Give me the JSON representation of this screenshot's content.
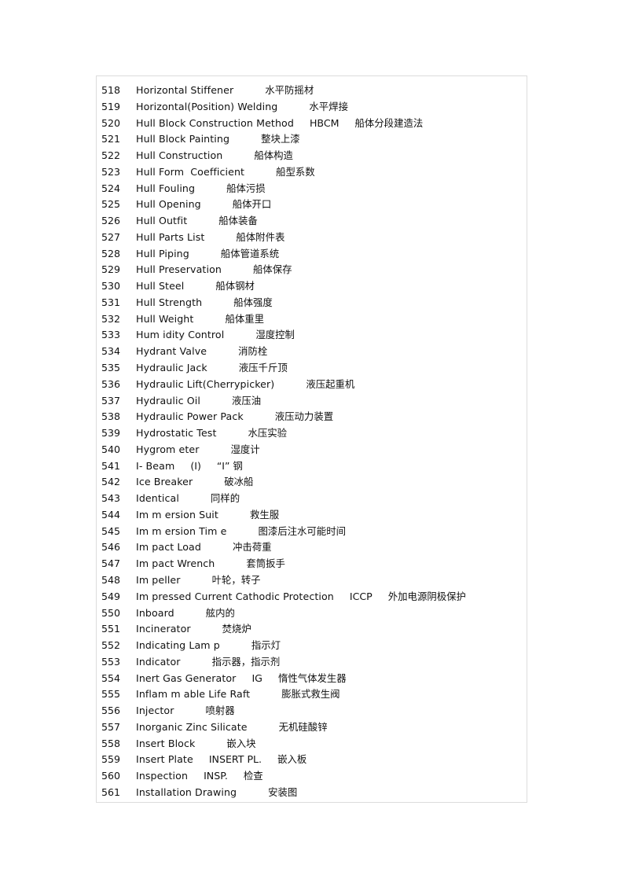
{
  "glossary": {
    "entries": [
      {
        "num": "518",
        "term": "Horizontal Stiffener",
        "abbr": "",
        "zh": "水平防摇材"
      },
      {
        "num": "519",
        "term": "Horizontal(Position) Welding",
        "abbr": "",
        "zh": "水平焊接"
      },
      {
        "num": "520",
        "term": "Hull Block Construction Method",
        "abbr": "HBCM",
        "zh": "船体分段建造法"
      },
      {
        "num": "521",
        "term": "Hull Block Painting",
        "abbr": "",
        "zh": "整块上漆"
      },
      {
        "num": "522",
        "term": "Hull Construction",
        "abbr": "",
        "zh": "船体构造"
      },
      {
        "num": "523",
        "term": "Hull Form  Coefficient",
        "abbr": "",
        "zh": "船型系数"
      },
      {
        "num": "524",
        "term": "Hull Fouling",
        "abbr": "",
        "zh": "船体污损"
      },
      {
        "num": "525",
        "term": "Hull Opening",
        "abbr": "",
        "zh": "船体开口"
      },
      {
        "num": "526",
        "term": "Hull Outfit",
        "abbr": "",
        "zh": "船体装备"
      },
      {
        "num": "527",
        "term": "Hull Parts List",
        "abbr": "",
        "zh": "船体附件表"
      },
      {
        "num": "528",
        "term": "Hull Piping",
        "abbr": "",
        "zh": "船体管道系统"
      },
      {
        "num": "529",
        "term": "Hull Preservation",
        "abbr": "",
        "zh": "船体保存"
      },
      {
        "num": "530",
        "term": "Hull Steel",
        "abbr": "",
        "zh": "船体钢材"
      },
      {
        "num": "531",
        "term": "Hull Strength",
        "abbr": "",
        "zh": "船体强度"
      },
      {
        "num": "532",
        "term": "Hull Weight",
        "abbr": "",
        "zh": "船体重里"
      },
      {
        "num": "533",
        "term": "Hum idity Control",
        "abbr": "",
        "zh": "湿度控制"
      },
      {
        "num": "534",
        "term": "Hydrant Valve",
        "abbr": "",
        "zh": "消防栓"
      },
      {
        "num": "535",
        "term": "Hydraulic Jack",
        "abbr": "",
        "zh": "液压千斤顶"
      },
      {
        "num": "536",
        "term": "Hydraulic Lift(Cherrypicker)",
        "abbr": "",
        "zh": "液压起重机"
      },
      {
        "num": "537",
        "term": "Hydraulic Oil",
        "abbr": "",
        "zh": "液压油"
      },
      {
        "num": "538",
        "term": "Hydraulic Power Pack",
        "abbr": "",
        "zh": "液压动力装置"
      },
      {
        "num": "539",
        "term": "Hydrostatic Test",
        "abbr": "",
        "zh": "水压实验"
      },
      {
        "num": "540",
        "term": "Hygrom eter",
        "abbr": "",
        "zh": "湿度计"
      },
      {
        "num": "541",
        "term": "I- Beam",
        "abbr": "(I)",
        "zh": "“I” 钢"
      },
      {
        "num": "542",
        "term": "Ice Breaker",
        "abbr": "",
        "zh": "破冰船"
      },
      {
        "num": "543",
        "term": "Identical",
        "abbr": "",
        "zh": "同样的"
      },
      {
        "num": "544",
        "term": "Im m ersion Suit",
        "abbr": "",
        "zh": "救生服"
      },
      {
        "num": "545",
        "term": "Im m ersion Tim e",
        "abbr": "",
        "zh": "图漆后注水可能时间"
      },
      {
        "num": "546",
        "term": "Im pact Load",
        "abbr": "",
        "zh": "冲击荷重"
      },
      {
        "num": "547",
        "term": "Im pact Wrench",
        "abbr": "",
        "zh": "套筒扳手"
      },
      {
        "num": "548",
        "term": "Im peller",
        "abbr": "",
        "zh": "叶轮，转子"
      },
      {
        "num": "549",
        "term": "Im pressed Current Cathodic Protection",
        "abbr": "ICCP",
        "zh": "外加电源阴极保护"
      },
      {
        "num": "550",
        "term": "Inboard",
        "abbr": "",
        "zh": "舷内的"
      },
      {
        "num": "551",
        "term": "Incinerator",
        "abbr": "",
        "zh": "焚烧炉"
      },
      {
        "num": "552",
        "term": "Indicating Lam p",
        "abbr": "",
        "zh": "指示灯"
      },
      {
        "num": "553",
        "term": "Indicator",
        "abbr": "",
        "zh": "指示器，指示剂"
      },
      {
        "num": "554",
        "term": "Inert Gas Generator",
        "abbr": "IG",
        "zh": "惰性气体发生器"
      },
      {
        "num": "555",
        "term": "Inflam m able Life Raft",
        "abbr": "",
        "zh": "膨胀式救生阀"
      },
      {
        "num": "556",
        "term": "Injector",
        "abbr": "",
        "zh": "喷射器"
      },
      {
        "num": "557",
        "term": "Inorganic Zinc Silicate",
        "abbr": "",
        "zh": "无机硅酸锌"
      },
      {
        "num": "558",
        "term": "Insert Block",
        "abbr": "",
        "zh": "嵌入块"
      },
      {
        "num": "559",
        "term": "Insert Plate",
        "abbr": "INSERT PL.",
        "zh": "嵌入板"
      },
      {
        "num": "560",
        "term": "Inspection",
        "abbr": "INSP.",
        "zh": "检查"
      },
      {
        "num": "561",
        "term": "Installation Drawing",
        "abbr": "",
        "zh": "安装图"
      }
    ]
  }
}
